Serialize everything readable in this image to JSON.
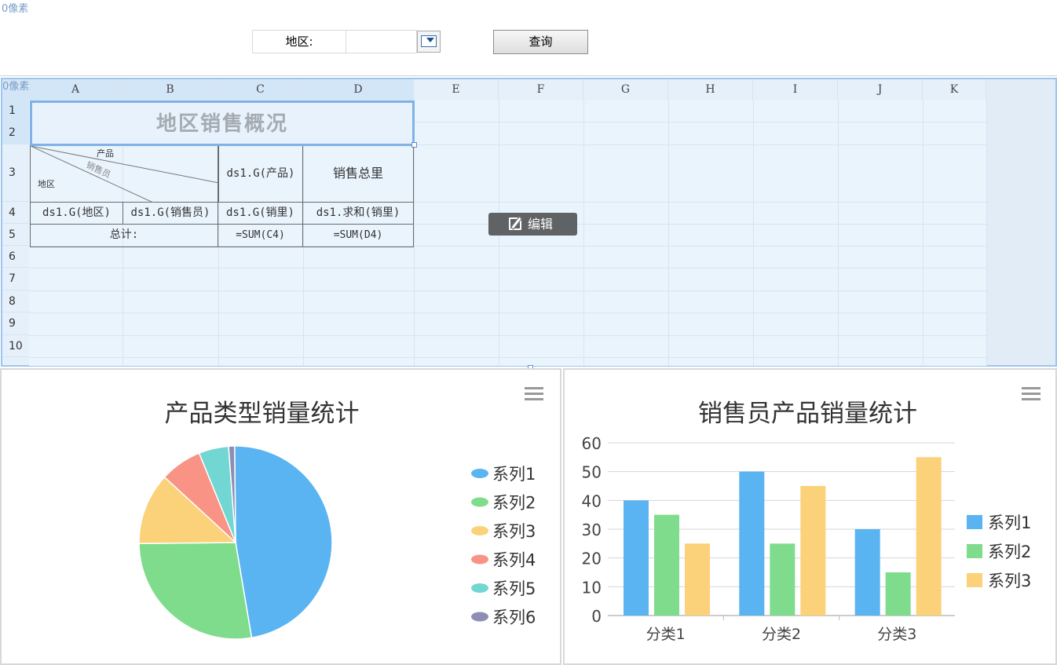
{
  "param_area": {
    "px_label": "0像素",
    "region_label": "地区:",
    "region_value": "",
    "query_label": "查询"
  },
  "sheet": {
    "px_label": "0像素",
    "columns": [
      "A",
      "B",
      "C",
      "D",
      "E",
      "F",
      "G",
      "H",
      "I",
      "J",
      "K"
    ],
    "rows": [
      "1",
      "2",
      "3",
      "4",
      "5",
      "6",
      "7",
      "8",
      "9",
      "10"
    ],
    "title": "地区销售概况",
    "slash_header": {
      "product": "产品",
      "salesman": "销售员",
      "region": "地区"
    },
    "row3": {
      "c": "ds1.G(产品)",
      "d": "销售总里"
    },
    "row4": {
      "a": "ds1.G(地区)",
      "b": "ds1.G(销售员)",
      "c": "ds1.G(销里)",
      "d": "ds1.求和(销里)"
    },
    "row5": {
      "ab": "总计:",
      "c": "=SUM(C4)",
      "d": "=SUM(D4)"
    },
    "edit_label": "编辑"
  },
  "chart_data": [
    {
      "type": "pie",
      "title": "产品类型销量统计",
      "series": [
        {
          "name": "系列1",
          "value": 47.5,
          "color": "#5ab4f2"
        },
        {
          "name": "系列2",
          "value": 27.5,
          "color": "#7fdc8c"
        },
        {
          "name": "系列3",
          "value": 12.0,
          "color": "#fbd179"
        },
        {
          "name": "系列4",
          "value": 7.0,
          "color": "#f89385"
        },
        {
          "name": "系列5",
          "value": 5.0,
          "color": "#72d6d2"
        },
        {
          "name": "系列6",
          "value": 1.0,
          "color": "#8e8eb5"
        }
      ]
    },
    {
      "type": "bar",
      "title": "销售员产品销量统计",
      "categories": [
        "分类1",
        "分类2",
        "分类3"
      ],
      "ylim": [
        0,
        60
      ],
      "yticks": [
        "0",
        "10",
        "20",
        "30",
        "40",
        "50",
        "60"
      ],
      "grid": true,
      "legend_position": "right",
      "series": [
        {
          "name": "系列1",
          "values": [
            40,
            50,
            30
          ],
          "color": "#5ab4f2"
        },
        {
          "name": "系列2",
          "values": [
            35,
            25,
            15
          ],
          "color": "#7fdc8c"
        },
        {
          "name": "系列3",
          "values": [
            25,
            45,
            55
          ],
          "color": "#fbd179"
        }
      ]
    }
  ]
}
